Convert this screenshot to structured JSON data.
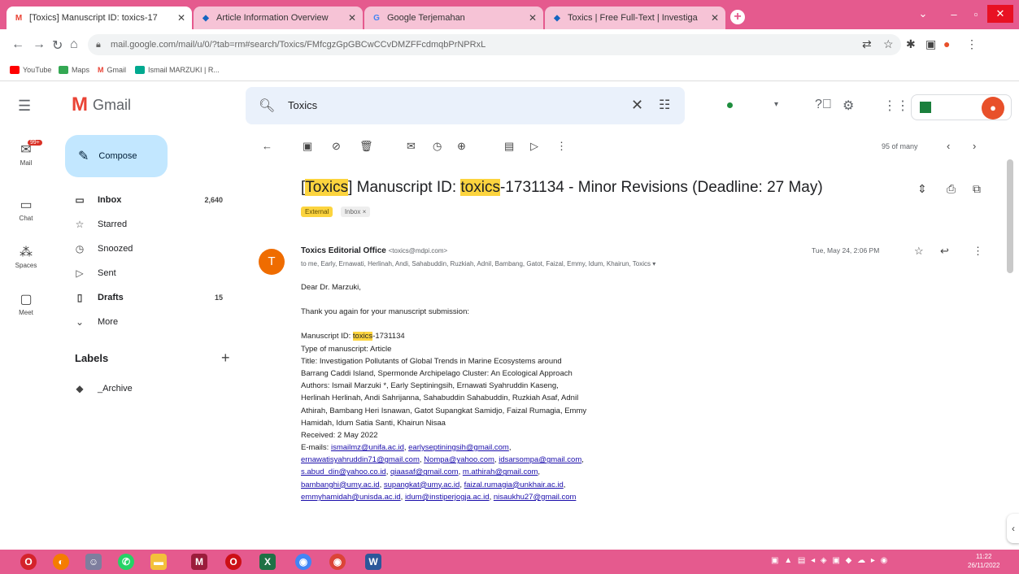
{
  "browser": {
    "tabs": [
      {
        "label": "[Toxics] Manuscript ID: toxics-17",
        "favicon": "gmail-icon"
      },
      {
        "label": "Article Information Overview",
        "favicon": "mdpi-icon"
      },
      {
        "label": "Google Terjemahan",
        "favicon": "translate-icon"
      },
      {
        "label": "Toxics | Free Full-Text | Investiga",
        "favicon": "mdpi-icon"
      }
    ],
    "url": "mail.google.com/mail/u/0/?tab=rm#search/Toxics/FMfcgzGpGBCwCCvDMZFFcdmqbPrNPRxL",
    "bookmarks": [
      "YouTube",
      "Maps",
      "Gmail",
      "Ismail MARZUKI | R..."
    ]
  },
  "gmail": {
    "app_name": "Gmail",
    "search_value": "Toxics",
    "rail": {
      "mail": "Mail",
      "mail_badge": "99+",
      "chat": "Chat",
      "spaces": "Spaces",
      "meet": "Meet"
    },
    "compose": "Compose",
    "nav": [
      {
        "label": "Inbox",
        "count": "2,640",
        "icon": "inbox-icon"
      },
      {
        "label": "Starred",
        "count": "",
        "icon": "star-icon"
      },
      {
        "label": "Snoozed",
        "count": "",
        "icon": "clock-icon"
      },
      {
        "label": "Sent",
        "count": "",
        "icon": "send-icon"
      },
      {
        "label": "Drafts",
        "count": "15",
        "icon": "draft-icon"
      },
      {
        "label": "More",
        "count": "",
        "icon": "chevron-down-icon"
      }
    ],
    "labels_title": "Labels",
    "labels": [
      "_Archive"
    ],
    "pager": "95 of many"
  },
  "email": {
    "subject_pre": "[",
    "subject_hl1": "Toxics",
    "subject_mid": "] Manuscript ID: ",
    "subject_hl2": "toxics",
    "subject_post": "-1731134 - Minor Revisions (Deadline: 27 May)",
    "chip_external": "External",
    "chip_inbox": "Inbox ×",
    "sender_initial": "T",
    "sender_name": "Toxics Editorial Office",
    "sender_email": "<toxics@mdpi.com>",
    "recipients": "to me, Early, Ernawati, Herlinah, Andi, Sahabuddin, Ruzkiah, Adnil, Bambang, Gatot, Faizal, Emmy, Idum, Khairun, Toxics ▾",
    "time": "Tue, May 24, 2:06 PM",
    "greeting": "Dear Dr. Marzuki,",
    "thanks": "Thank you again for your manuscript submission:",
    "ms_id_pre": "Manuscript ID: ",
    "ms_id_hl": "toxics",
    "ms_id_post": "-1731134",
    "type": "Type of manuscript: Article",
    "title1": "Title: Investigation Pollutants of Global Trends in Marine Ecosystems around",
    "title2": "Barrang Caddi Island, Spermonde Archipelago Cluster: An Ecological Approach",
    "authors1": "Authors: Ismail Marzuki *, Early Septiningsih, Ernawati Syahruddin Kaseng,",
    "authors2": "Herlinah Herlinah, Andi Sahrijanna, Sahabuddin Sahabuddin, Ruzkiah Asaf, Adnil",
    "authors3": "Athirah, Bambang Heri Isnawan, Gatot Supangkat Samidjo, Faizal Rumagia, Emmy",
    "authors4": "Hamidah, Idum Satia Santi, Khairun Nisaa",
    "received": "Received: 2 May 2022",
    "emails_label": "E-mails: ",
    "e1": "ismailmz@unifa.ac.id",
    "e2": "earlyseptiningsih@gmail.com",
    "e3": "ernawatisyahruddin71@gmail.com",
    "e4": "Nompa@yahoo.com",
    "e5": "idsarsompa@gmail.com",
    "e6": "s.abud_din@yahoo.co.id",
    "e7": "qiaasaf@gmail.com",
    "e8": "m.athirah@gmail.com",
    "e9": "bambanghi@umy.ac.id",
    "e10": "supangkat@umy.ac.id",
    "e11": "faizal.rumagia@unkhair.ac.id",
    "e12": "emmyhamidah@unisda.ac.id",
    "e13": "idum@instiperjogja.ac.id",
    "e14": "nisaukhu27@gmail.com"
  },
  "taskbar": {
    "time": "11:22",
    "date": "26/11/2022"
  },
  "colors": {
    "accent_pink": "#e55a8e",
    "highlight": "#fcd43e",
    "compose_bg": "#c2e7ff"
  }
}
